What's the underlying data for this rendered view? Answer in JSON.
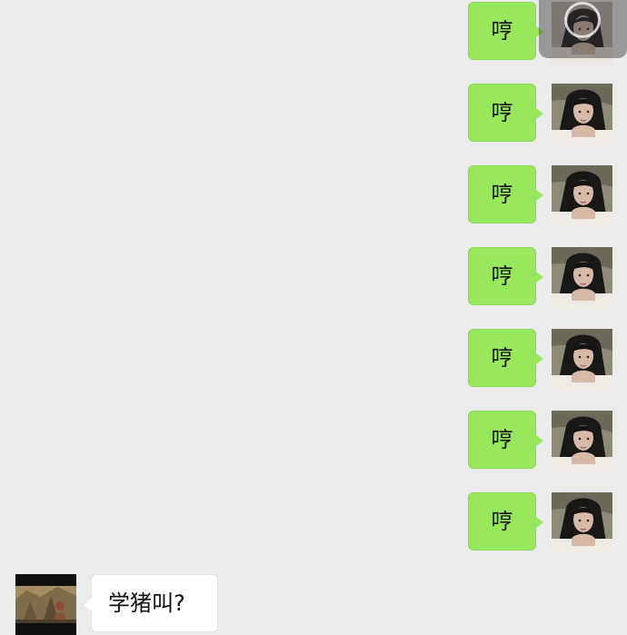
{
  "chat": {
    "messages": [
      {
        "direction": "sent",
        "text": "哼"
      },
      {
        "direction": "sent",
        "text": "哼"
      },
      {
        "direction": "sent",
        "text": "哼"
      },
      {
        "direction": "sent",
        "text": "哼"
      },
      {
        "direction": "sent",
        "text": "哼"
      },
      {
        "direction": "sent",
        "text": "哼"
      },
      {
        "direction": "sent",
        "text": "哼"
      },
      {
        "direction": "received",
        "text": "学猪叫?"
      }
    ]
  },
  "colors": {
    "background": "#ebebeb",
    "sent_bubble": "#97e85d",
    "received_bubble": "#ffffff",
    "text": "#111111"
  },
  "icons": {
    "self_avatar": "portrait-photo-icon",
    "other_avatar": "scene-photo-icon",
    "overlay_control": "floating-circle-icon"
  }
}
